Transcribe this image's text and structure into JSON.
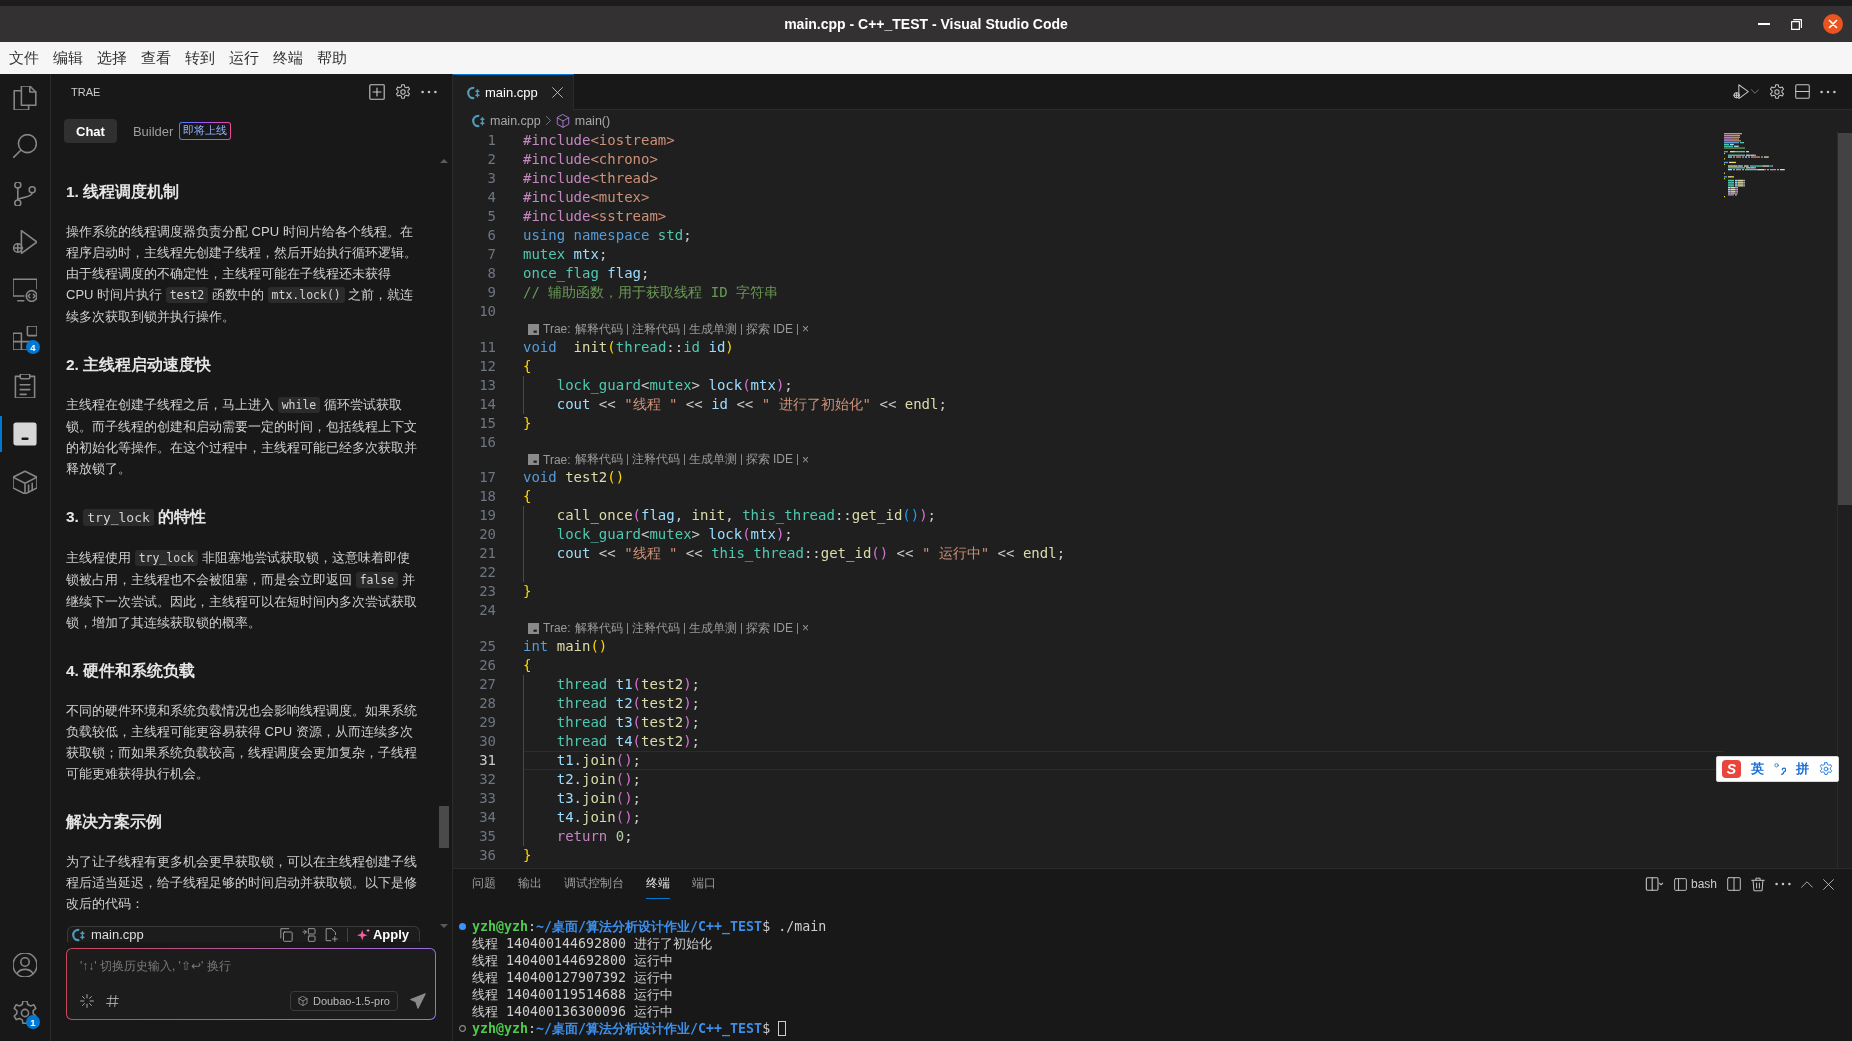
{
  "window": {
    "title": "main.cpp - C++_TEST - Visual Studio Code"
  },
  "menu": [
    "文件",
    "编辑",
    "选择",
    "查看",
    "转到",
    "运行",
    "终端",
    "帮助"
  ],
  "activity_bar": {
    "items": [
      {
        "kind": "explorer",
        "selected": false
      },
      {
        "kind": "search",
        "selected": false
      },
      {
        "kind": "source_control",
        "selected": false
      },
      {
        "kind": "run",
        "selected": false
      },
      {
        "kind": "remote",
        "selected": false
      },
      {
        "kind": "extensions",
        "selected": false,
        "badge": "4"
      },
      {
        "kind": "testing",
        "selected": false
      },
      {
        "kind": "trae",
        "selected": true
      },
      {
        "kind": "containers",
        "selected": false
      }
    ],
    "bottom": [
      {
        "kind": "account"
      },
      {
        "kind": "manage",
        "badge": "1"
      }
    ]
  },
  "side_panel": {
    "title": "TRAE",
    "tabs": [
      {
        "label": "Chat",
        "selected": true
      },
      {
        "label": "Builder",
        "selected": false,
        "badge": "即将上线"
      }
    ],
    "message": [
      {
        "kind": "heading",
        "segments": [
          {
            "kind": "text",
            "text": "1. 线程调度机制"
          }
        ]
      },
      {
        "kind": "paragraph",
        "segments": [
          {
            "kind": "text",
            "text": "操作系统的线程调度器负责分配 CPU 时间片给各个线程。在程序启动时，主线程先创建子线程，然后开始执行循环逻辑。由于线程调度的不确定性，主线程可能在子线程还未获得 CPU 时间片执行 "
          },
          {
            "kind": "code",
            "text": "test2"
          },
          {
            "kind": "text",
            "text": " 函数中的 "
          },
          {
            "kind": "code",
            "text": "mtx.lock()"
          },
          {
            "kind": "text",
            "text": " 之前，就连续多次获取到锁并执行操作。"
          }
        ]
      },
      {
        "kind": "heading",
        "segments": [
          {
            "kind": "text",
            "text": "2. 主线程启动速度快"
          }
        ]
      },
      {
        "kind": "paragraph",
        "segments": [
          {
            "kind": "text",
            "text": "主线程在创建子线程之后，马上进入 "
          },
          {
            "kind": "code",
            "text": "while"
          },
          {
            "kind": "text",
            "text": " 循环尝试获取锁。而子线程的创建和启动需要一定的时间，包括线程上下文的初始化等操作。在这个过程中，主线程可能已经多次获取并释放锁了。"
          }
        ]
      },
      {
        "kind": "heading",
        "segments": [
          {
            "kind": "text",
            "text": "3. "
          },
          {
            "kind": "code",
            "text": "try_lock"
          },
          {
            "kind": "text",
            "text": " 的特性"
          }
        ]
      },
      {
        "kind": "paragraph",
        "segments": [
          {
            "kind": "text",
            "text": "主线程使用 "
          },
          {
            "kind": "code",
            "text": "try_lock"
          },
          {
            "kind": "text",
            "text": " 非阻塞地尝试获取锁，这意味着即使锁被占用，主线程也不会被阻塞，而是会立即返回 "
          },
          {
            "kind": "code",
            "text": "false"
          },
          {
            "kind": "text",
            "text": " 并继续下一次尝试。因此，主线程可以在短时间内多次尝试获取锁，增加了其连续获取锁的概率。"
          }
        ]
      },
      {
        "kind": "heading",
        "segments": [
          {
            "kind": "text",
            "text": "4. 硬件和系统负载"
          }
        ]
      },
      {
        "kind": "paragraph",
        "segments": [
          {
            "kind": "text",
            "text": "不同的硬件环境和系统负载情况也会影响线程调度。如果系统负载较低，主线程可能更容易获得 CPU 资源，从而连续多次获取锁；而如果系统负载较高，线程调度会更加复杂，子线程可能更难获得执行机会。"
          }
        ]
      },
      {
        "kind": "heading",
        "segments": [
          {
            "kind": "text",
            "text": "解决方案示例"
          }
        ]
      },
      {
        "kind": "paragraph",
        "segments": [
          {
            "kind": "text",
            "text": "为了让子线程有更多机会更早获取锁，可以在主线程创建子线程后适当延迟，给子线程足够的时间启动并获取锁。以下是修改后的代码："
          }
        ]
      }
    ],
    "code_block": {
      "filename": "main.cpp",
      "action": "Apply"
    },
    "composer": {
      "placeholder": "'↑↓' 切换历史输入, '⇧↩' 换行",
      "model": "Doubao-1.5-pro"
    }
  },
  "editor": {
    "tabs": [
      {
        "label": "main.cpp",
        "selected": true
      }
    ],
    "breadcrumb": [
      {
        "kind": "file",
        "label": "main.cpp"
      },
      {
        "kind": "function",
        "label": "main()"
      }
    ],
    "rows": [
      {
        "kind": "code",
        "number": "1",
        "current": false,
        "indented": false,
        "tokens": [
          {
            "kind": "control",
            "text": "#include"
          },
          {
            "kind": "string",
            "text": "<iostream>"
          }
        ]
      },
      {
        "kind": "code",
        "number": "2",
        "current": false,
        "indented": false,
        "tokens": [
          {
            "kind": "control",
            "text": "#include"
          },
          {
            "kind": "string",
            "text": "<chrono>"
          }
        ]
      },
      {
        "kind": "code",
        "number": "3",
        "current": false,
        "indented": false,
        "tokens": [
          {
            "kind": "control",
            "text": "#include"
          },
          {
            "kind": "string",
            "text": "<thread>"
          }
        ]
      },
      {
        "kind": "code",
        "number": "4",
        "current": false,
        "indented": false,
        "tokens": [
          {
            "kind": "control",
            "text": "#include"
          },
          {
            "kind": "string",
            "text": "<mutex>"
          }
        ]
      },
      {
        "kind": "code",
        "number": "5",
        "current": false,
        "indented": false,
        "tokens": [
          {
            "kind": "control",
            "text": "#include"
          },
          {
            "kind": "string",
            "text": "<sstream>"
          }
        ]
      },
      {
        "kind": "code",
        "number": "6",
        "current": false,
        "indented": false,
        "tokens": [
          {
            "kind": "keyword",
            "text": "using namespace "
          },
          {
            "kind": "type",
            "text": "std"
          },
          {
            "kind": "plain",
            "text": ";"
          }
        ]
      },
      {
        "kind": "code",
        "number": "7",
        "current": false,
        "indented": false,
        "tokens": [
          {
            "kind": "type",
            "text": "mutex "
          },
          {
            "kind": "variable",
            "text": "mtx"
          },
          {
            "kind": "plain",
            "text": ";"
          }
        ]
      },
      {
        "kind": "code",
        "number": "8",
        "current": false,
        "indented": false,
        "tokens": [
          {
            "kind": "type",
            "text": "once_flag "
          },
          {
            "kind": "variable",
            "text": "flag"
          },
          {
            "kind": "plain",
            "text": ";"
          }
        ]
      },
      {
        "kind": "code",
        "number": "9",
        "current": false,
        "indented": false,
        "tokens": [
          {
            "kind": "comment",
            "text": "// 辅助函数，用于获取线程 ID 字符串"
          }
        ]
      },
      {
        "kind": "code",
        "number": "10",
        "current": false,
        "indented": false
      },
      {
        "kind": "lens",
        "label": "Trae:",
        "actions": [
          "解释代码",
          "注释代码",
          "生成单测",
          "探索 IDE"
        ],
        "close": "×"
      },
      {
        "kind": "code",
        "number": "11",
        "current": false,
        "indented": false,
        "tokens": [
          {
            "kind": "keyword",
            "text": "void  "
          },
          {
            "kind": "function",
            "text": "init"
          },
          {
            "kind": "bracket1",
            "text": "("
          },
          {
            "kind": "type",
            "text": "thread"
          },
          {
            "kind": "plain",
            "text": "::"
          },
          {
            "kind": "type",
            "text": "id "
          },
          {
            "kind": "variable",
            "text": "id"
          },
          {
            "kind": "bracket1",
            "text": ")"
          }
        ]
      },
      {
        "kind": "code",
        "number": "12",
        "current": false,
        "indented": false,
        "tokens": [
          {
            "kind": "bracket1",
            "text": "{"
          }
        ]
      },
      {
        "kind": "code",
        "number": "13",
        "current": false,
        "indented": true,
        "tokens": [
          {
            "kind": "type",
            "text": "lock_guard"
          },
          {
            "kind": "plain",
            "text": "<"
          },
          {
            "kind": "type",
            "text": "mutex"
          },
          {
            "kind": "plain",
            "text": "> "
          },
          {
            "kind": "variable",
            "text": "lock"
          },
          {
            "kind": "bracket2",
            "text": "("
          },
          {
            "kind": "variable",
            "text": "mtx"
          },
          {
            "kind": "bracket2",
            "text": ")"
          },
          {
            "kind": "plain",
            "text": ";"
          }
        ]
      },
      {
        "kind": "code",
        "number": "14",
        "current": false,
        "indented": true,
        "tokens": [
          {
            "kind": "variable",
            "text": "cout"
          },
          {
            "kind": "plain",
            "text": " << "
          },
          {
            "kind": "string",
            "text": "\"线程 \""
          },
          {
            "kind": "plain",
            "text": " << "
          },
          {
            "kind": "variable",
            "text": "id"
          },
          {
            "kind": "plain",
            "text": " << "
          },
          {
            "kind": "string",
            "text": "\" 进行了初始化\""
          },
          {
            "kind": "plain",
            "text": " << "
          },
          {
            "kind": "function",
            "text": "endl"
          },
          {
            "kind": "plain",
            "text": ";"
          }
        ]
      },
      {
        "kind": "code",
        "number": "15",
        "current": false,
        "indented": false,
        "tokens": [
          {
            "kind": "bracket1",
            "text": "}"
          }
        ]
      },
      {
        "kind": "code",
        "number": "16",
        "current": false,
        "indented": false
      },
      {
        "kind": "lens",
        "label": "Trae:",
        "actions": [
          "解释代码",
          "注释代码",
          "生成单测",
          "探索 IDE"
        ],
        "close": "×"
      },
      {
        "kind": "code",
        "number": "17",
        "current": false,
        "indented": false,
        "tokens": [
          {
            "kind": "keyword",
            "text": "void "
          },
          {
            "kind": "function",
            "text": "test2"
          },
          {
            "kind": "bracket1",
            "text": "()"
          }
        ]
      },
      {
        "kind": "code",
        "number": "18",
        "current": false,
        "indented": false,
        "tokens": [
          {
            "kind": "bracket1",
            "text": "{"
          }
        ]
      },
      {
        "kind": "code",
        "number": "19",
        "current": false,
        "indented": true,
        "tokens": [
          {
            "kind": "function",
            "text": "call_once"
          },
          {
            "kind": "bracket2",
            "text": "("
          },
          {
            "kind": "variable",
            "text": "flag"
          },
          {
            "kind": "plain",
            "text": ", "
          },
          {
            "kind": "function",
            "text": "init"
          },
          {
            "kind": "plain",
            "text": ", "
          },
          {
            "kind": "type",
            "text": "this_thread"
          },
          {
            "kind": "plain",
            "text": "::"
          },
          {
            "kind": "function",
            "text": "get_id"
          },
          {
            "kind": "bracket3",
            "text": "()"
          },
          {
            "kind": "bracket2",
            "text": ")"
          },
          {
            "kind": "plain",
            "text": ";"
          }
        ]
      },
      {
        "kind": "code",
        "number": "20",
        "current": false,
        "indented": true,
        "tokens": [
          {
            "kind": "type",
            "text": "lock_guard"
          },
          {
            "kind": "plain",
            "text": "<"
          },
          {
            "kind": "type",
            "text": "mutex"
          },
          {
            "kind": "plain",
            "text": "> "
          },
          {
            "kind": "variable",
            "text": "lock"
          },
          {
            "kind": "bracket2",
            "text": "("
          },
          {
            "kind": "variable",
            "text": "mtx"
          },
          {
            "kind": "bracket2",
            "text": ")"
          },
          {
            "kind": "plain",
            "text": ";"
          }
        ]
      },
      {
        "kind": "code",
        "number": "21",
        "current": false,
        "indented": true,
        "tokens": [
          {
            "kind": "variable",
            "text": "cout"
          },
          {
            "kind": "plain",
            "text": " << "
          },
          {
            "kind": "string",
            "text": "\"线程 \""
          },
          {
            "kind": "plain",
            "text": " << "
          },
          {
            "kind": "type",
            "text": "this_thread"
          },
          {
            "kind": "plain",
            "text": "::"
          },
          {
            "kind": "function",
            "text": "get_id"
          },
          {
            "kind": "bracket2",
            "text": "()"
          },
          {
            "kind": "plain",
            "text": " << "
          },
          {
            "kind": "string",
            "text": "\" 运行中\""
          },
          {
            "kind": "plain",
            "text": " << "
          },
          {
            "kind": "function",
            "text": "endl"
          },
          {
            "kind": "plain",
            "text": ";"
          }
        ]
      },
      {
        "kind": "code",
        "number": "22",
        "current": false,
        "indented": true
      },
      {
        "kind": "code",
        "number": "23",
        "current": false,
        "indented": false,
        "tokens": [
          {
            "kind": "bracket1",
            "text": "}"
          }
        ]
      },
      {
        "kind": "code",
        "number": "24",
        "current": false,
        "indented": false
      },
      {
        "kind": "lens",
        "label": "Trae:",
        "actions": [
          "解释代码",
          "注释代码",
          "生成单测",
          "探索 IDE"
        ],
        "close": "×"
      },
      {
        "kind": "code",
        "number": "25",
        "current": false,
        "indented": false,
        "tokens": [
          {
            "kind": "keyword",
            "text": "int "
          },
          {
            "kind": "function",
            "text": "main"
          },
          {
            "kind": "bracket1",
            "text": "()"
          }
        ]
      },
      {
        "kind": "code",
        "number": "26",
        "current": false,
        "indented": false,
        "tokens": [
          {
            "kind": "bracket1",
            "text": "{"
          }
        ]
      },
      {
        "kind": "code",
        "number": "27",
        "current": false,
        "indented": true,
        "tokens": [
          {
            "kind": "type",
            "text": "thread "
          },
          {
            "kind": "variable",
            "text": "t1"
          },
          {
            "kind": "bracket2",
            "text": "("
          },
          {
            "kind": "function",
            "text": "test2"
          },
          {
            "kind": "bracket2",
            "text": ")"
          },
          {
            "kind": "plain",
            "text": ";"
          }
        ]
      },
      {
        "kind": "code",
        "number": "28",
        "current": false,
        "indented": true,
        "tokens": [
          {
            "kind": "type",
            "text": "thread "
          },
          {
            "kind": "variable",
            "text": "t2"
          },
          {
            "kind": "bracket2",
            "text": "("
          },
          {
            "kind": "function",
            "text": "test2"
          },
          {
            "kind": "bracket2",
            "text": ")"
          },
          {
            "kind": "plain",
            "text": ";"
          }
        ]
      },
      {
        "kind": "code",
        "number": "29",
        "current": false,
        "indented": true,
        "tokens": [
          {
            "kind": "type",
            "text": "thread "
          },
          {
            "kind": "variable",
            "text": "t3"
          },
          {
            "kind": "bracket2",
            "text": "("
          },
          {
            "kind": "function",
            "text": "test2"
          },
          {
            "kind": "bracket2",
            "text": ")"
          },
          {
            "kind": "plain",
            "text": ";"
          }
        ]
      },
      {
        "kind": "code",
        "number": "30",
        "current": false,
        "indented": true,
        "tokens": [
          {
            "kind": "type",
            "text": "thread "
          },
          {
            "kind": "variable",
            "text": "t4"
          },
          {
            "kind": "bracket2",
            "text": "("
          },
          {
            "kind": "function",
            "text": "test2"
          },
          {
            "kind": "bracket2",
            "text": ")"
          },
          {
            "kind": "plain",
            "text": ";"
          }
        ]
      },
      {
        "kind": "code",
        "number": "31",
        "current": true,
        "indented": true,
        "tokens": [
          {
            "kind": "variable",
            "text": "t1"
          },
          {
            "kind": "plain",
            "text": "."
          },
          {
            "kind": "function",
            "text": "join"
          },
          {
            "kind": "bracket2",
            "text": "()"
          },
          {
            "kind": "plain",
            "text": ";"
          }
        ]
      },
      {
        "kind": "code",
        "number": "32",
        "current": false,
        "indented": true,
        "tokens": [
          {
            "kind": "variable",
            "text": "t2"
          },
          {
            "kind": "plain",
            "text": "."
          },
          {
            "kind": "function",
            "text": "join"
          },
          {
            "kind": "bracket2",
            "text": "()"
          },
          {
            "kind": "plain",
            "text": ";"
          }
        ]
      },
      {
        "kind": "code",
        "number": "33",
        "current": false,
        "indented": true,
        "tokens": [
          {
            "kind": "variable",
            "text": "t3"
          },
          {
            "kind": "plain",
            "text": "."
          },
          {
            "kind": "function",
            "text": "join"
          },
          {
            "kind": "bracket2",
            "text": "()"
          },
          {
            "kind": "plain",
            "text": ";"
          }
        ]
      },
      {
        "kind": "code",
        "number": "34",
        "current": false,
        "indented": true,
        "tokens": [
          {
            "kind": "variable",
            "text": "t4"
          },
          {
            "kind": "plain",
            "text": "."
          },
          {
            "kind": "function",
            "text": "join"
          },
          {
            "kind": "bracket2",
            "text": "()"
          },
          {
            "kind": "plain",
            "text": ";"
          }
        ]
      },
      {
        "kind": "code",
        "number": "35",
        "current": false,
        "indented": true,
        "tokens": [
          {
            "kind": "control",
            "text": "return "
          },
          {
            "kind": "number",
            "text": "0"
          },
          {
            "kind": "plain",
            "text": ";"
          }
        ]
      },
      {
        "kind": "code",
        "number": "36",
        "current": false,
        "indented": false,
        "tokens": [
          {
            "kind": "bracket1",
            "text": "}"
          }
        ]
      }
    ]
  },
  "ime_toolbar": {
    "logo": "S",
    "mode": "英",
    "input_mode": "拼"
  },
  "panel": {
    "tabs": [
      {
        "label": "问题",
        "selected": false
      },
      {
        "label": "输出",
        "selected": false
      },
      {
        "label": "调试控制台",
        "selected": false
      },
      {
        "label": "终端",
        "selected": true
      },
      {
        "label": "端口",
        "selected": false
      }
    ],
    "terminal": {
      "shell": "bash",
      "lines": [
        {
          "kind": "prompt",
          "finished": true,
          "user": "yzh@yzh",
          "separator": ":",
          "path": "~/桌面/算法分析设计作业/C++_TEST",
          "command": "$ ./main",
          "cursor": false
        },
        {
          "kind": "output",
          "text": "线程 140400144692800 进行了初始化"
        },
        {
          "kind": "output",
          "text": "线程 140400144692800 运行中"
        },
        {
          "kind": "output",
          "text": "线程 140400127907392 运行中"
        },
        {
          "kind": "output",
          "text": "线程 140400119514688 运行中"
        },
        {
          "kind": "output",
          "text": "线程 140400136300096 运行中"
        },
        {
          "kind": "prompt",
          "finished": false,
          "user": "yzh@yzh",
          "separator": ":",
          "path": "~/桌面/算法分析设计作业/C++_TEST",
          "command": "$",
          "cursor": true
        }
      ]
    }
  }
}
